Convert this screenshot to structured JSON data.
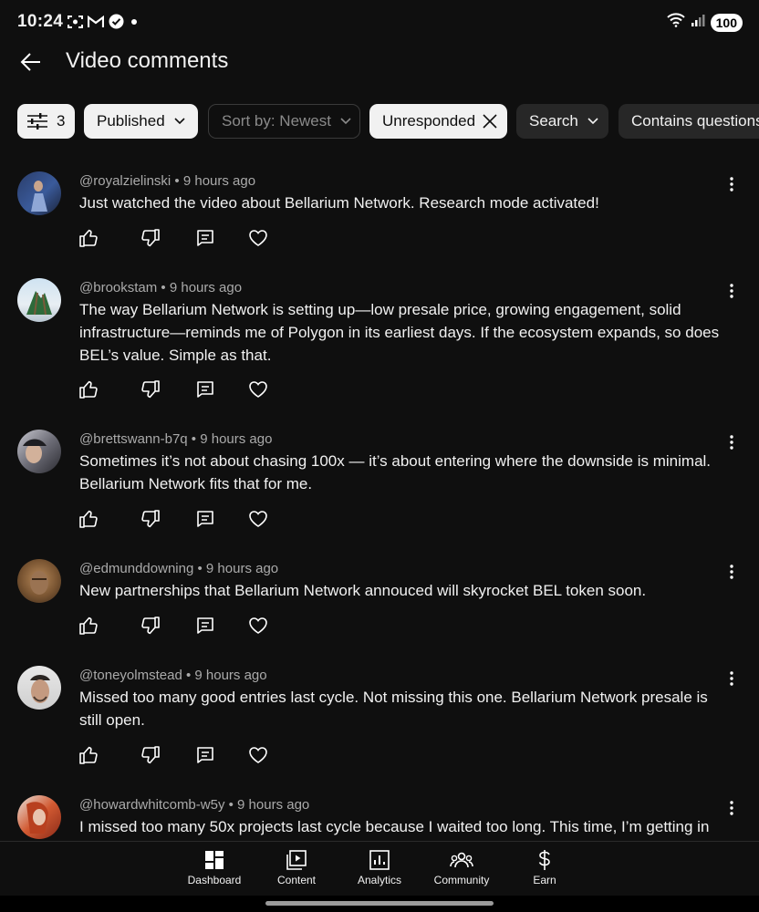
{
  "status_bar": {
    "time": "10:24",
    "left_icons": [
      "screenshot-icon",
      "gmail-icon",
      "check-badge-icon",
      "dot-icon"
    ],
    "right_icons": [
      "wifi-icon",
      "signal-icon"
    ],
    "battery": "100"
  },
  "header": {
    "title": "Video comments",
    "back_icon": "back-arrow-icon"
  },
  "filters": {
    "filter_count": "3",
    "published_label": "Published",
    "sort_label": "Sort by: Newest",
    "unresponded_label": "Unresponded",
    "search_label": "Search",
    "contains_label": "Contains questions"
  },
  "comments": [
    {
      "author": "@royalzielinski",
      "time": "9 hours ago",
      "text": "Just watched the video about Bellarium Network. Research mode activated!"
    },
    {
      "author": "@brookstam",
      "time": "9 hours ago",
      "text": "The way Bellarium Network is setting up—low presale price, growing engagement, solid infrastructure—reminds me of Polygon in its earliest days. If the ecosystem expands, so does BEL’s value. Simple as that."
    },
    {
      "author": "@brettswann-b7q",
      "time": "9 hours ago",
      "text": "Sometimes it’s not about chasing 100x — it’s about entering where the downside is minimal. Bellarium Network fits that for me."
    },
    {
      "author": "@edmunddowning",
      "time": "9 hours ago",
      "text": "New partnerships that Bellarium Network annouced will skyrocket BEL token soon."
    },
    {
      "author": "@toneyolmstead",
      "time": "9 hours ago",
      "text": "Missed too many good entries last cycle. Not missing this one. Bellarium Network presale is still open."
    },
    {
      "author": "@howardwhitcomb-w5y",
      "time": "9 hours ago",
      "text": "I missed too many 50x projects last cycle because I waited too long. This time, I’m getting in"
    }
  ],
  "bottom_nav": {
    "items": [
      {
        "label": "Dashboard",
        "icon": "dashboard-icon"
      },
      {
        "label": "Content",
        "icon": "content-icon"
      },
      {
        "label": "Analytics",
        "icon": "analytics-icon"
      },
      {
        "label": "Community",
        "icon": "community-icon"
      },
      {
        "label": "Earn",
        "icon": "earn-icon"
      }
    ]
  },
  "colors": {
    "background": "#0f0f0f",
    "chip_light": "#f1f1f1",
    "chip_dark": "#272727",
    "text_secondary": "#aaaaaa"
  }
}
